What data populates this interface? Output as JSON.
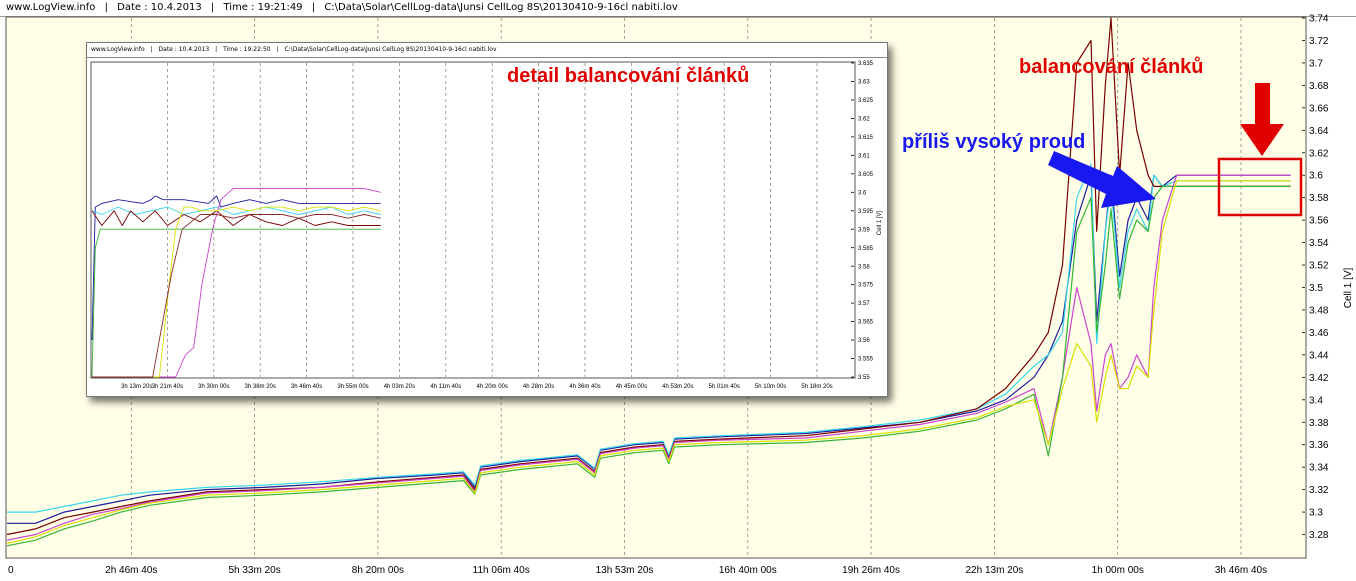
{
  "header": {
    "site": "www.LogView.info",
    "date": "Date : 10.4.2013",
    "time": "Time : 19:21:49",
    "path": "C:\\Data\\Solar\\CellLog-data\\Junsi CellLog 8S\\20130410-9-16cl nabiti.lov",
    "sep": "|"
  },
  "colors": {
    "plot_bg": "#ffffe8",
    "grid": "#8a8a8a",
    "annotation_red": "#e00000",
    "annotation_blue": "#1818f0",
    "series": [
      "#1c1c9c",
      "#3ad6ec",
      "#7a0000",
      "#cc44cc",
      "#36b436",
      "#d8e000",
      "#8a2a2a",
      "#2a6a2a"
    ]
  },
  "annotations": {
    "detail": "detail balancování článků",
    "balancing": "balancování článků",
    "current": "příliš vysoký proud"
  },
  "chart_data": [
    {
      "type": "line",
      "title": "",
      "ylabel": "Cell 1 [V]",
      "ylim": [
        3.26,
        3.74
      ],
      "y_ticks": [
        3.28,
        3.3,
        3.32,
        3.34,
        3.36,
        3.38,
        3.4,
        3.42,
        3.44,
        3.46,
        3.48,
        3.5,
        3.52,
        3.54,
        3.56,
        3.58,
        3.6,
        3.62,
        3.64,
        3.66,
        3.68,
        3.7,
        3.72,
        3.74
      ],
      "x_tick_labels": [
        "0",
        "2h 46m 40s",
        "5h 33m 20s",
        "8h 20m 00s",
        "11h 06m 40s",
        "13h 53m 20s",
        "16h 40m 00s",
        "19h 26m 40s",
        "22h 13m 20s",
        "1h 00m 00s",
        "3h 46m 40s"
      ],
      "x_range_hours": [
        0,
        45.5
      ],
      "grid": "vertical dashed",
      "series": [
        {
          "x": [
            0,
            1,
            2,
            3,
            4,
            5,
            7,
            9,
            11,
            13,
            15,
            16,
            16.4,
            16.6,
            18,
            20,
            20.6,
            20.8,
            22,
            23,
            23.2,
            23.4,
            25,
            28,
            30,
            32,
            34,
            35,
            36,
            36.5,
            37,
            37.5,
            38,
            38.2,
            38.5,
            38.7,
            39,
            39.3,
            39.6,
            40,
            40.2,
            40.5,
            41,
            41.3,
            42,
            43,
            44,
            45
          ],
          "values": [
            3.29,
            3.29,
            3.3,
            3.305,
            3.31,
            3.315,
            3.32,
            3.322,
            3.325,
            3.33,
            3.333,
            3.335,
            3.322,
            3.34,
            3.345,
            3.35,
            3.338,
            3.355,
            3.36,
            3.362,
            3.35,
            3.365,
            3.367,
            3.37,
            3.375,
            3.38,
            3.39,
            3.4,
            3.42,
            3.44,
            3.47,
            3.56,
            3.6,
            3.47,
            3.55,
            3.6,
            3.51,
            3.56,
            3.58,
            3.56,
            3.6,
            3.59,
            3.6,
            3.6,
            3.6,
            3.6,
            3.6,
            3.6
          ]
        },
        {
          "x": [
            0,
            1,
            2,
            3,
            4,
            5,
            7,
            9,
            11,
            13,
            15,
            16,
            16.4,
            16.6,
            18,
            20,
            20.6,
            20.8,
            22,
            23,
            23.2,
            23.4,
            25,
            28,
            30,
            32,
            34,
            35,
            36,
            36.5,
            37,
            37.5,
            38,
            38.2,
            38.5,
            38.7,
            39,
            39.3,
            39.6,
            40,
            40.2,
            40.5,
            41,
            41.3,
            42,
            43,
            44,
            45
          ],
          "values": [
            3.3,
            3.3,
            3.305,
            3.31,
            3.315,
            3.318,
            3.322,
            3.324,
            3.327,
            3.331,
            3.334,
            3.336,
            3.324,
            3.341,
            3.346,
            3.351,
            3.339,
            3.356,
            3.361,
            3.363,
            3.351,
            3.366,
            3.368,
            3.371,
            3.376,
            3.382,
            3.392,
            3.405,
            3.43,
            3.44,
            3.46,
            3.58,
            3.61,
            3.45,
            3.55,
            3.59,
            3.5,
            3.55,
            3.57,
            3.55,
            3.6,
            3.59,
            3.595,
            3.595,
            3.595,
            3.595,
            3.595,
            3.595
          ]
        },
        {
          "x": [
            0,
            1,
            2,
            3,
            4,
            5,
            7,
            9,
            11,
            13,
            15,
            16,
            16.4,
            16.6,
            18,
            20,
            20.6,
            20.8,
            22,
            23,
            23.2,
            23.4,
            25,
            28,
            30,
            32,
            34,
            35,
            36,
            36.5,
            37,
            37.5,
            38,
            38.2,
            38.5,
            38.7,
            39,
            39.3,
            39.6,
            40,
            40.2,
            40.5,
            41,
            41.3,
            42,
            43,
            44,
            45
          ],
          "values": [
            3.28,
            3.285,
            3.295,
            3.3,
            3.305,
            3.31,
            3.318,
            3.32,
            3.322,
            3.327,
            3.331,
            3.333,
            3.32,
            3.338,
            3.343,
            3.348,
            3.336,
            3.353,
            3.358,
            3.36,
            3.348,
            3.363,
            3.365,
            3.368,
            3.374,
            3.38,
            3.392,
            3.41,
            3.44,
            3.46,
            3.52,
            3.7,
            3.72,
            3.55,
            3.68,
            3.74,
            3.6,
            3.7,
            3.64,
            3.6,
            3.59,
            3.59,
            3.59,
            3.59,
            3.59,
            3.59,
            3.59,
            3.59
          ]
        },
        {
          "x": [
            0,
            1,
            2,
            3,
            4,
            5,
            7,
            9,
            11,
            13,
            15,
            16,
            16.4,
            16.6,
            18,
            20,
            20.6,
            20.8,
            22,
            23,
            23.2,
            23.4,
            25,
            28,
            30,
            32,
            34,
            35,
            36,
            36.5,
            37,
            37.5,
            38,
            38.2,
            38.5,
            38.7,
            39,
            39.3,
            39.6,
            40,
            40.2,
            40.5,
            41,
            41.3,
            42,
            43,
            44,
            45
          ],
          "values": [
            3.275,
            3.28,
            3.29,
            3.298,
            3.303,
            3.309,
            3.317,
            3.319,
            3.322,
            3.326,
            3.33,
            3.332,
            3.318,
            3.337,
            3.342,
            3.347,
            3.335,
            3.352,
            3.357,
            3.359,
            3.347,
            3.362,
            3.364,
            3.366,
            3.372,
            3.378,
            3.388,
            3.398,
            3.41,
            3.36,
            3.42,
            3.5,
            3.45,
            3.39,
            3.44,
            3.45,
            3.41,
            3.42,
            3.44,
            3.42,
            3.5,
            3.56,
            3.6,
            3.6,
            3.6,
            3.6,
            3.6,
            3.6
          ]
        },
        {
          "x": [
            0,
            1,
            2,
            3,
            4,
            5,
            7,
            9,
            11,
            13,
            15,
            16,
            16.4,
            16.6,
            18,
            20,
            20.6,
            20.8,
            22,
            23,
            23.2,
            23.4,
            25,
            28,
            30,
            32,
            34,
            35,
            36,
            36.5,
            37,
            37.5,
            38,
            38.2,
            38.5,
            38.7,
            39,
            39.3,
            39.6,
            40,
            40.2,
            40.5,
            41,
            41.3,
            42,
            43,
            44,
            45
          ],
          "values": [
            3.27,
            3.275,
            3.285,
            3.292,
            3.3,
            3.306,
            3.313,
            3.315,
            3.318,
            3.322,
            3.326,
            3.328,
            3.316,
            3.333,
            3.338,
            3.343,
            3.331,
            3.348,
            3.353,
            3.355,
            3.343,
            3.358,
            3.36,
            3.362,
            3.366,
            3.372,
            3.382,
            3.392,
            3.405,
            3.35,
            3.42,
            3.55,
            3.58,
            3.46,
            3.52,
            3.57,
            3.49,
            3.54,
            3.56,
            3.55,
            3.58,
            3.59,
            3.59,
            3.59,
            3.59,
            3.59,
            3.59,
            3.59
          ]
        },
        {
          "x": [
            0,
            1,
            2,
            3,
            4,
            5,
            7,
            9,
            11,
            13,
            15,
            16,
            16.4,
            16.6,
            18,
            20,
            20.6,
            20.8,
            22,
            23,
            23.2,
            23.4,
            25,
            28,
            30,
            32,
            34,
            35,
            36,
            36.5,
            37,
            37.5,
            38,
            38.2,
            38.5,
            38.7,
            39,
            39.3,
            39.6,
            40,
            40.2,
            40.5,
            41,
            41.3,
            42,
            43,
            44,
            45
          ],
          "values": [
            3.272,
            3.278,
            3.288,
            3.295,
            3.302,
            3.308,
            3.315,
            3.317,
            3.32,
            3.324,
            3.328,
            3.33,
            3.317,
            3.335,
            3.34,
            3.345,
            3.333,
            3.35,
            3.355,
            3.357,
            3.345,
            3.36,
            3.362,
            3.364,
            3.368,
            3.374,
            3.384,
            3.394,
            3.4,
            3.36,
            3.41,
            3.45,
            3.43,
            3.38,
            3.42,
            3.44,
            3.41,
            3.41,
            3.43,
            3.42,
            3.48,
            3.55,
            3.595,
            3.595,
            3.595,
            3.595,
            3.595,
            3.595
          ]
        }
      ]
    },
    {
      "type": "line",
      "title": "",
      "ylabel": "Cell 1 [V]",
      "ylim": [
        3.55,
        3.635
      ],
      "y_ticks": [
        3.55,
        3.555,
        3.56,
        3.565,
        3.57,
        3.575,
        3.58,
        3.585,
        3.59,
        3.595,
        3.6,
        3.605,
        3.61,
        3.615,
        3.62,
        3.625,
        3.63,
        3.635
      ],
      "x_tick_labels": [
        "3h 13m 20s",
        "3h 21m 40s",
        "3h 30m 00s",
        "3h 38m 20s",
        "3h 46m 40s",
        "3h 55m 00s",
        "4h 03m 20s",
        "4h 11m 40s",
        "4h 20m 00s",
        "4h 28m 20s",
        "4h 36m 40s",
        "4h 45m 00s",
        "4h 53m 20s",
        "5h 01m 40s",
        "5h 10m 00s",
        "5h 18m 20s"
      ],
      "x_range_minutes": [
        188,
        1117
      ],
      "grid": "vertical dashed",
      "series": [
        {
          "x": [
            188,
            192,
            200,
            220,
            250,
            260,
            265,
            275,
            300,
            330,
            340,
            345,
            360,
            380,
            400,
            420,
            440,
            500,
            520,
            540
          ],
          "values": [
            3.56,
            3.596,
            3.597,
            3.598,
            3.597,
            3.598,
            3.599,
            3.598,
            3.598,
            3.597,
            3.599,
            3.596,
            3.597,
            3.598,
            3.597,
            3.598,
            3.597,
            3.597,
            3.597,
            3.597
          ]
        },
        {
          "x": [
            188,
            200,
            220,
            240,
            260,
            280,
            300,
            320,
            340,
            360,
            380,
            400,
            420,
            440,
            460,
            480,
            500,
            520,
            540
          ],
          "values": [
            3.595,
            3.594,
            3.596,
            3.594,
            3.595,
            3.596,
            3.594,
            3.595,
            3.596,
            3.594,
            3.595,
            3.596,
            3.595,
            3.594,
            3.595,
            3.596,
            3.594,
            3.595,
            3.594
          ]
        },
        {
          "x": [
            188,
            200,
            215,
            225,
            235,
            250,
            265,
            280,
            300,
            320,
            340,
            360,
            380,
            400,
            420,
            440,
            460,
            480,
            500,
            520,
            540
          ],
          "values": [
            3.595,
            3.591,
            3.595,
            3.591,
            3.595,
            3.592,
            3.595,
            3.591,
            3.594,
            3.592,
            3.595,
            3.591,
            3.594,
            3.592,
            3.591,
            3.593,
            3.591,
            3.592,
            3.591,
            3.591,
            3.591
          ]
        },
        {
          "x": [
            188,
            290,
            302,
            312,
            322,
            335,
            345,
            360,
            380,
            400,
            420,
            440,
            460,
            480,
            500,
            520,
            540
          ],
          "values": [
            3.55,
            3.55,
            3.556,
            3.558,
            3.575,
            3.59,
            3.598,
            3.601,
            3.601,
            3.601,
            3.601,
            3.601,
            3.601,
            3.601,
            3.601,
            3.601,
            3.6
          ]
        },
        {
          "x": [
            188,
            192,
            198,
            290,
            305,
            318,
            330,
            345,
            360,
            380,
            400,
            420,
            440,
            460,
            480,
            500,
            520,
            540
          ],
          "values": [
            3.55,
            3.585,
            3.59,
            3.59,
            3.59,
            3.59,
            3.59,
            3.59,
            3.59,
            3.59,
            3.59,
            3.59,
            3.59,
            3.59,
            3.59,
            3.59,
            3.59,
            3.59
          ]
        },
        {
          "x": [
            188,
            270,
            275,
            282,
            290,
            300,
            310,
            320,
            340,
            360,
            380,
            400,
            420,
            440,
            460,
            480,
            500,
            520,
            540
          ],
          "values": [
            3.55,
            3.55,
            3.56,
            3.575,
            3.59,
            3.596,
            3.596,
            3.595,
            3.595,
            3.596,
            3.595,
            3.596,
            3.596,
            3.595,
            3.596,
            3.596,
            3.595,
            3.596,
            3.595
          ]
        },
        {
          "x": [
            188,
            262,
            270,
            285,
            298,
            320,
            340,
            360,
            380,
            400,
            420,
            440,
            460,
            480,
            500,
            520,
            540
          ],
          "values": [
            3.55,
            3.55,
            3.56,
            3.578,
            3.59,
            3.594,
            3.594,
            3.593,
            3.594,
            3.594,
            3.594,
            3.593,
            3.594,
            3.594,
            3.593,
            3.594,
            3.593
          ]
        }
      ]
    }
  ]
}
